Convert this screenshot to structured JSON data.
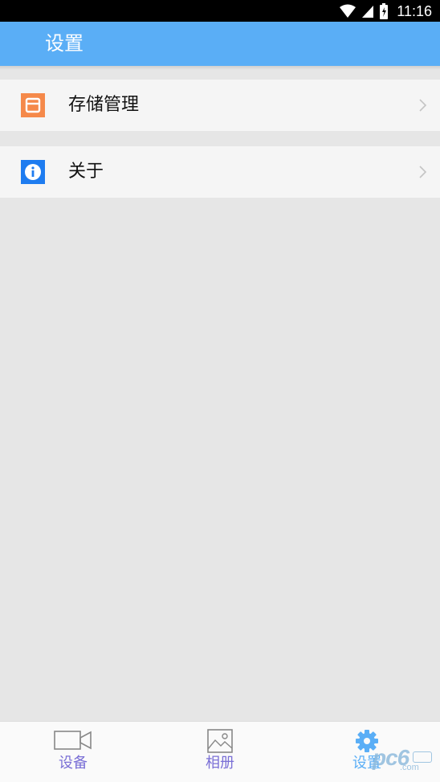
{
  "status_bar": {
    "time": "11:16",
    "icons": [
      "wifi-icon",
      "cell-signal-icon",
      "battery-icon"
    ]
  },
  "app_bar": {
    "title": "设置",
    "color": "#5aaef6"
  },
  "settings": {
    "items": [
      {
        "label": "存储管理",
        "icon": "storage-icon",
        "icon_color": "#f5894a"
      },
      {
        "label": "关于",
        "icon": "info-icon",
        "icon_color": "#1e7cf0"
      }
    ]
  },
  "bottom_nav": {
    "items": [
      {
        "label": "设备",
        "icon": "video-camera-icon",
        "color": "#7a6fd6"
      },
      {
        "label": "相册",
        "icon": "photo-icon",
        "color": "#7a6fd6"
      },
      {
        "label": "设置",
        "icon": "gear-icon",
        "color": "#5aaef6",
        "active": true
      }
    ]
  },
  "watermark": {
    "text": "pc6",
    "suffix": ".com"
  }
}
